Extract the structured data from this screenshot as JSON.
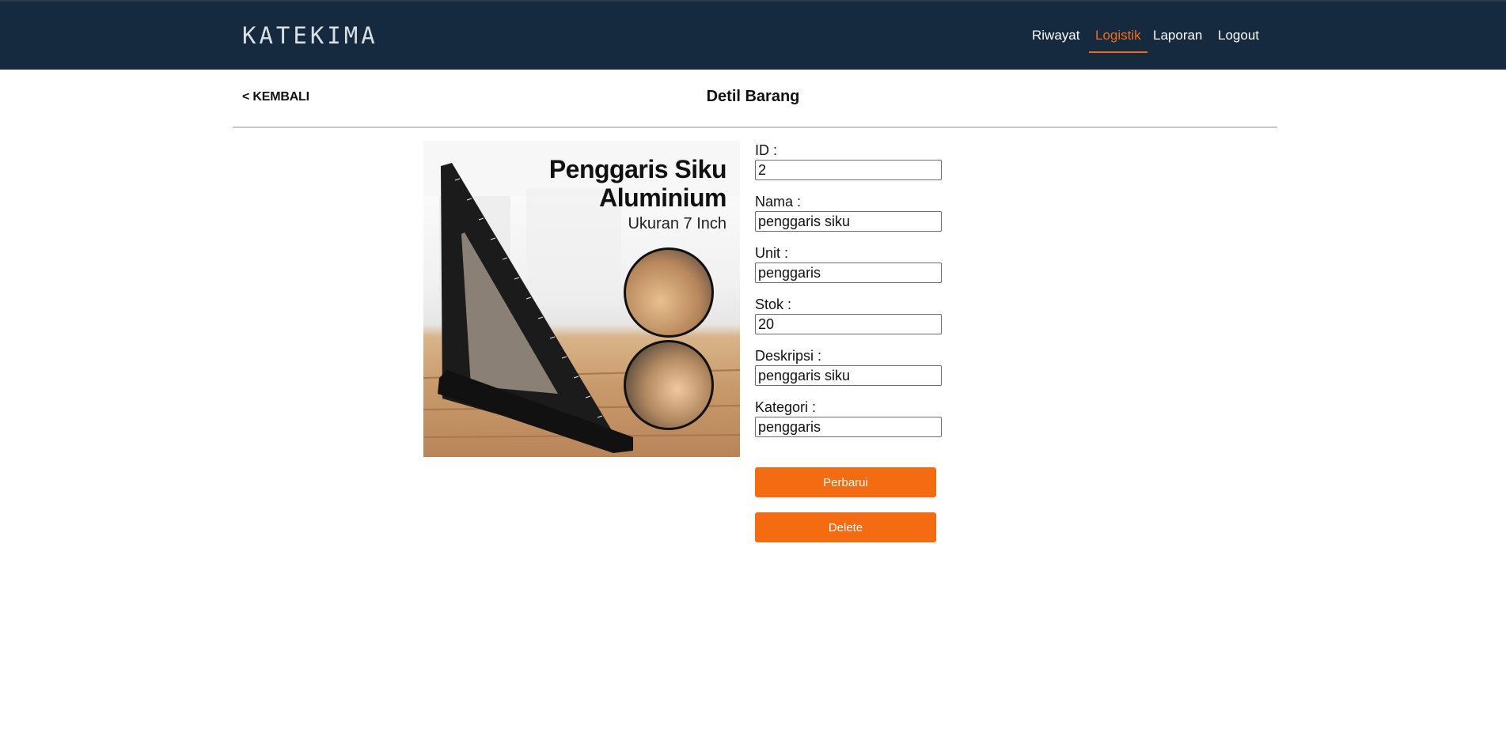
{
  "header": {
    "logo": "KATEKIMA",
    "nav": [
      "Riwayat",
      "Logistik",
      "Laporan",
      "Logout"
    ],
    "active_nav": "Logistik",
    "accent_color": "#f46b1c",
    "bg_color": "#152a3e"
  },
  "page": {
    "back_label": "< KEMBALI",
    "title": "Detil Barang"
  },
  "product_image": {
    "title_line1": "Penggaris Siku",
    "title_line2": "Aluminium",
    "subtitle": "Ukuran 7 Inch"
  },
  "form": {
    "fields": [
      {
        "label": "ID :",
        "value": "2"
      },
      {
        "label": "Nama :",
        "value": "penggaris siku"
      },
      {
        "label": "Unit :",
        "value": "penggaris"
      },
      {
        "label": "Stok :",
        "value": "20"
      },
      {
        "label": "Deskripsi :",
        "value": "penggaris siku"
      },
      {
        "label": "Kategori :",
        "value": "penggaris"
      }
    ],
    "update_label": "Perbarui",
    "delete_label": "Delete",
    "button_color": "#f46b12"
  }
}
